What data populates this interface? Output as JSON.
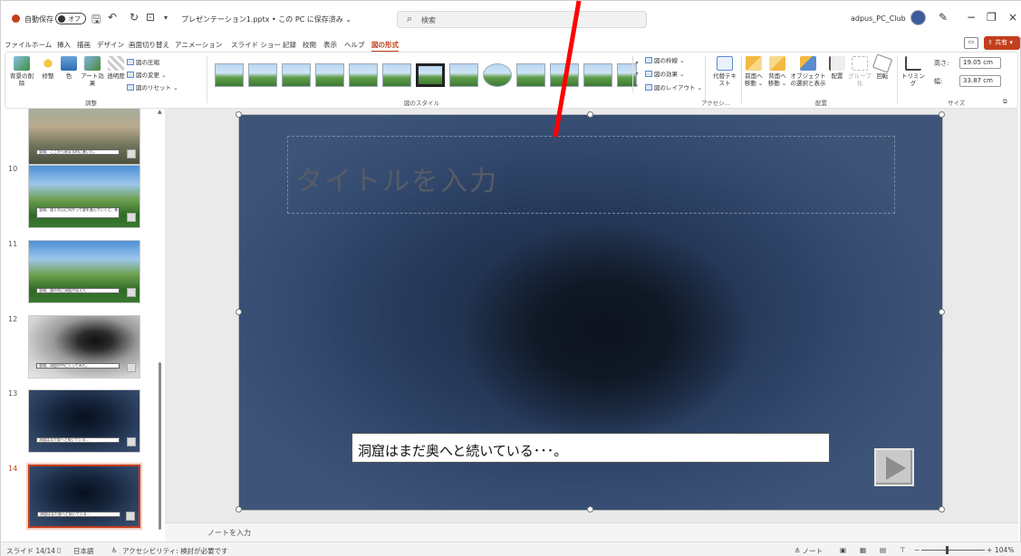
{
  "titlebar": {
    "autosave_label": "自動保存",
    "autosave_state": "オフ",
    "filename": "プレゼンテーション1.pptx • この PC に保存済み ⌄",
    "search_placeholder": "検索",
    "user": "adpus_PC_Club"
  },
  "menu": {
    "tabs": [
      "ファイル",
      "ホーム",
      "挿入",
      "描画",
      "デザイン",
      "画面切り替え",
      "アニメーション",
      "スライド ショー",
      "記録",
      "校閲",
      "表示",
      "ヘルプ",
      "図の形式"
    ],
    "active_tab": "図の形式",
    "share_label": "共有"
  },
  "ribbon": {
    "adjust": {
      "remove_bg": "背景の削除",
      "corrections": "修整",
      "color": "色",
      "artistic": "アート効果",
      "transparency": "透明度",
      "compress": "図の圧縮",
      "change": "図の変更 ⌄",
      "reset": "図のリセット ⌄",
      "group_label": "調整"
    },
    "styles": {
      "group_label": "図のスタイル",
      "border": "図の枠線 ⌄",
      "effects": "図の効果 ⌄",
      "layout": "図のレイアウト ⌄"
    },
    "accessibility": {
      "alt_text": "代替テキスト",
      "group_label": "アクセシ..."
    },
    "arrange": {
      "forward": "前面へ移動 ⌄",
      "backward": "背面へ移動 ⌄",
      "selection_pane": "オブジェクトの選択と表示",
      "align": "配置",
      "group": "グループ化",
      "rotate": "回転",
      "group_label": "配置"
    },
    "size": {
      "crop": "トリミング",
      "height_label": "高さ:",
      "height_value": "19.05 cm",
      "width_label": "幅:",
      "width_value": "33.87 cm",
      "group_label": "サイズ"
    }
  },
  "thumbnails": [
    {
      "num": "",
      "style": "t-town",
      "caption": "冒険、ここから始まる町に着いた。",
      "selected": false
    },
    {
      "num": "10",
      "style": "t-land",
      "caption": "冒険、遠くの山に向かって道を進んでいくと、新しい景色が見えてきた…",
      "selected": false
    },
    {
      "num": "11",
      "style": "t-land",
      "caption": "冒険、道の先に洞窟が見えた…",
      "selected": false
    },
    {
      "num": "12",
      "style": "t-cave",
      "caption": "冒険、洞窟の中に入ってみた。",
      "selected": false
    },
    {
      "num": "13",
      "style": "t-dark",
      "caption": "洞窟はまだ奥へと続いている…",
      "selected": false
    },
    {
      "num": "14",
      "style": "t-dark",
      "caption": "洞窟はまだ奥へと続いている…",
      "selected": true
    }
  ],
  "slide": {
    "title_placeholder": "タイトルを入力",
    "message": "洞窟はまだ奥へと続いている･･･。"
  },
  "notes_placeholder": "ノートを入力",
  "statusbar": {
    "slide_info": "スライド 14/14",
    "language": "日本語",
    "accessibility": "アクセシビリティ: 検討が必要です",
    "notes_btn": "ノート",
    "zoom": "104%"
  },
  "colors": {
    "accent": "#c43e1c",
    "annotation_arrow": "#ff0000"
  }
}
